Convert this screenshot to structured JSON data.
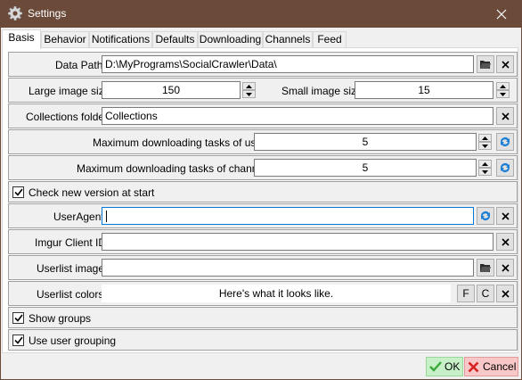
{
  "window": {
    "title": "Settings"
  },
  "tabs": [
    "Basis",
    "Behavior",
    "Notifications",
    "Defaults",
    "Downloading",
    "Channels",
    "Feed"
  ],
  "basis": {
    "data_path": {
      "label": "Data Path",
      "value": "D:\\MyPrograms\\SocialCrawler\\Data\\"
    },
    "large_image_size": {
      "label": "Large image size",
      "value": "150"
    },
    "small_image_size": {
      "label": "Small image size",
      "value": "15"
    },
    "collections_folder": {
      "label": "Collections folder",
      "value": "Collections"
    },
    "max_tasks_users": {
      "label": "Maximum downloading tasks of users",
      "value": "5"
    },
    "max_tasks_channels": {
      "label": "Maximum downloading tasks of channels",
      "value": "5"
    },
    "check_new_version": {
      "label": "Check new version at start",
      "checked": true
    },
    "user_agent": {
      "label": "UserAgent",
      "value": ""
    },
    "imgur_client_id": {
      "label": "Imgur Client ID",
      "value": ""
    },
    "userlist_image": {
      "label": "Userlist image",
      "value": ""
    },
    "userlist_colors": {
      "label": "Userlist colors",
      "preview": "Here's what it looks like.",
      "f_label": "F",
      "c_label": "C"
    },
    "show_groups": {
      "label": "Show groups",
      "checked": true
    },
    "use_user_grouping": {
      "label": "Use user grouping",
      "checked": true
    }
  },
  "footer": {
    "ok_label": "OK",
    "cancel_label": "Cancel"
  },
  "colors": {
    "titlebar": "#6b4a39",
    "focus": "#0078d7",
    "ok_bg": "#c8f0c8",
    "cancel_bg": "#f8c8c8"
  }
}
